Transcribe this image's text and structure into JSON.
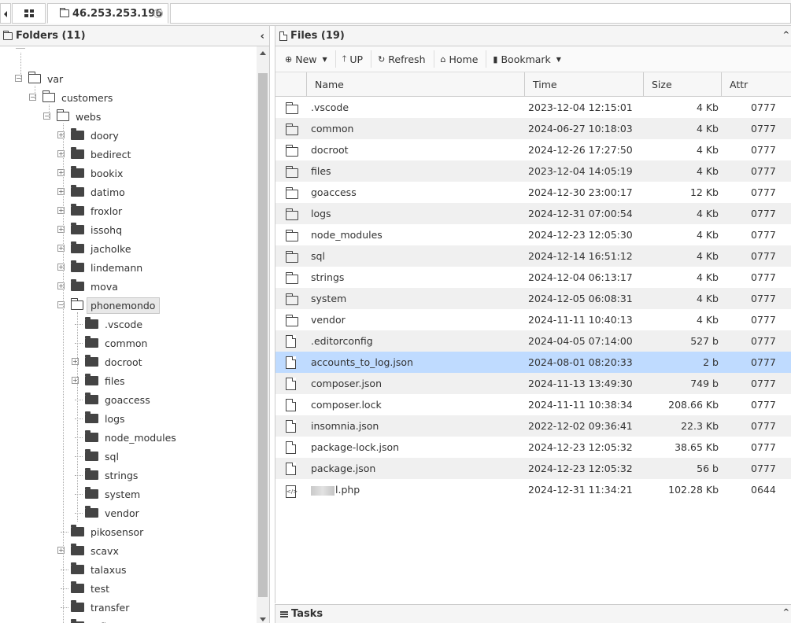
{
  "tabs": {
    "host": "46.253.253.196",
    "close": "⊗"
  },
  "folders_panel": {
    "title": "Folders (11)",
    "collapse": "‹",
    "tree": [
      {
        "label": "var",
        "depth": 1,
        "icon": "folder-open-icon",
        "expander": "−"
      },
      {
        "label": "customers",
        "depth": 2,
        "icon": "folder-open-icon",
        "expander": "−"
      },
      {
        "label": "webs",
        "depth": 3,
        "icon": "folder-open-icon",
        "expander": "−"
      },
      {
        "label": "doory",
        "depth": 4,
        "icon": "folder-icon",
        "expander": "+"
      },
      {
        "label": "bedirect",
        "depth": 4,
        "icon": "folder-icon",
        "expander": "+"
      },
      {
        "label": "bookix",
        "depth": 4,
        "icon": "folder-icon",
        "expander": "+"
      },
      {
        "label": "datimo",
        "depth": 4,
        "icon": "folder-icon",
        "expander": "+"
      },
      {
        "label": "froxlor",
        "depth": 4,
        "icon": "folder-icon",
        "expander": "+"
      },
      {
        "label": "issohq",
        "depth": 4,
        "icon": "folder-icon",
        "expander": "+"
      },
      {
        "label": "jacholke",
        "depth": 4,
        "icon": "folder-icon",
        "expander": "+"
      },
      {
        "label": "lindemann",
        "depth": 4,
        "icon": "folder-icon",
        "expander": "+"
      },
      {
        "label": "mova",
        "depth": 4,
        "icon": "folder-icon",
        "expander": "+"
      },
      {
        "label": "phonemondo",
        "depth": 4,
        "icon": "folder-open-icon",
        "expander": "−",
        "selected": true
      },
      {
        "label": ".vscode",
        "depth": 5,
        "icon": "folder-icon",
        "expander": ""
      },
      {
        "label": "common",
        "depth": 5,
        "icon": "folder-icon",
        "expander": ""
      },
      {
        "label": "docroot",
        "depth": 5,
        "icon": "folder-icon",
        "expander": "+"
      },
      {
        "label": "files",
        "depth": 5,
        "icon": "folder-icon",
        "expander": "+"
      },
      {
        "label": "goaccess",
        "depth": 5,
        "icon": "folder-icon",
        "expander": ""
      },
      {
        "label": "logs",
        "depth": 5,
        "icon": "folder-icon",
        "expander": ""
      },
      {
        "label": "node_modules",
        "depth": 5,
        "icon": "folder-icon",
        "expander": ""
      },
      {
        "label": "sql",
        "depth": 5,
        "icon": "folder-icon",
        "expander": ""
      },
      {
        "label": "strings",
        "depth": 5,
        "icon": "folder-icon",
        "expander": ""
      },
      {
        "label": "system",
        "depth": 5,
        "icon": "folder-icon",
        "expander": ""
      },
      {
        "label": "vendor",
        "depth": 5,
        "icon": "folder-icon",
        "expander": ""
      },
      {
        "label": "pikosensor",
        "depth": 4,
        "icon": "folder-icon",
        "expander": ""
      },
      {
        "label": "scavx",
        "depth": 4,
        "icon": "folder-icon",
        "expander": "+"
      },
      {
        "label": "talaxus",
        "depth": 4,
        "icon": "folder-icon",
        "expander": ""
      },
      {
        "label": "test",
        "depth": 4,
        "icon": "folder-icon",
        "expander": ""
      },
      {
        "label": "transfer",
        "depth": 4,
        "icon": "folder-icon",
        "expander": ""
      },
      {
        "label": "vtfip",
        "depth": 4,
        "icon": "folder-icon",
        "expander": ""
      }
    ]
  },
  "files_panel": {
    "title": "Files (19)",
    "toolbar": {
      "new": "New",
      "up": "UP",
      "refresh": "Refresh",
      "home": "Home",
      "bookmark": "Bookmark"
    },
    "columns": {
      "name": "Name",
      "time": "Time",
      "size": "Size",
      "attr": "Attr"
    },
    "files": [
      {
        "name": ".vscode",
        "time": "2023-12-04 12:15:01",
        "size": "4 Kb",
        "attr": "0777",
        "type": "folder"
      },
      {
        "name": "common",
        "time": "2024-06-27 10:18:03",
        "size": "4 Kb",
        "attr": "0777",
        "type": "folder"
      },
      {
        "name": "docroot",
        "time": "2024-12-26 17:27:50",
        "size": "4 Kb",
        "attr": "0777",
        "type": "folder"
      },
      {
        "name": "files",
        "time": "2023-12-04 14:05:19",
        "size": "4 Kb",
        "attr": "0777",
        "type": "folder"
      },
      {
        "name": "goaccess",
        "time": "2024-12-30 23:00:17",
        "size": "12 Kb",
        "attr": "0777",
        "type": "folder"
      },
      {
        "name": "logs",
        "time": "2024-12-31 07:00:54",
        "size": "4 Kb",
        "attr": "0777",
        "type": "folder"
      },
      {
        "name": "node_modules",
        "time": "2024-12-23 12:05:30",
        "size": "4 Kb",
        "attr": "0777",
        "type": "folder"
      },
      {
        "name": "sql",
        "time": "2024-12-14 16:51:12",
        "size": "4 Kb",
        "attr": "0777",
        "type": "folder"
      },
      {
        "name": "strings",
        "time": "2024-12-04 06:13:17",
        "size": "4 Kb",
        "attr": "0777",
        "type": "folder"
      },
      {
        "name": "system",
        "time": "2024-12-05 06:08:31",
        "size": "4 Kb",
        "attr": "0777",
        "type": "folder"
      },
      {
        "name": "vendor",
        "time": "2024-11-11 10:40:13",
        "size": "4 Kb",
        "attr": "0777",
        "type": "folder"
      },
      {
        "name": ".editorconfig",
        "time": "2024-04-05 07:14:00",
        "size": "527 b",
        "attr": "0777",
        "type": "file"
      },
      {
        "name": "accounts_to_log.json",
        "time": "2024-08-01 08:20:33",
        "size": "2 b",
        "attr": "0777",
        "type": "file",
        "selected": true
      },
      {
        "name": "composer.json",
        "time": "2024-11-13 13:49:30",
        "size": "749 b",
        "attr": "0777",
        "type": "file"
      },
      {
        "name": "composer.lock",
        "time": "2024-11-11 10:38:34",
        "size": "208.66 Kb",
        "attr": "0777",
        "type": "file"
      },
      {
        "name": "insomnia.json",
        "time": "2022-12-02 09:36:41",
        "size": "22.3 Kb",
        "attr": "0777",
        "type": "file"
      },
      {
        "name": "package-lock.json",
        "time": "2024-12-23 12:05:32",
        "size": "38.65 Kb",
        "attr": "0777",
        "type": "file"
      },
      {
        "name": "package.json",
        "time": "2024-12-23 12:05:32",
        "size": "56 b",
        "attr": "0777",
        "type": "file"
      },
      {
        "name": "l.php",
        "time": "2024-12-31 11:34:21",
        "size": "102.28 Kb",
        "attr": "0644",
        "type": "code",
        "redacted_prefix": true
      }
    ]
  },
  "tasks": {
    "title": "Tasks"
  }
}
